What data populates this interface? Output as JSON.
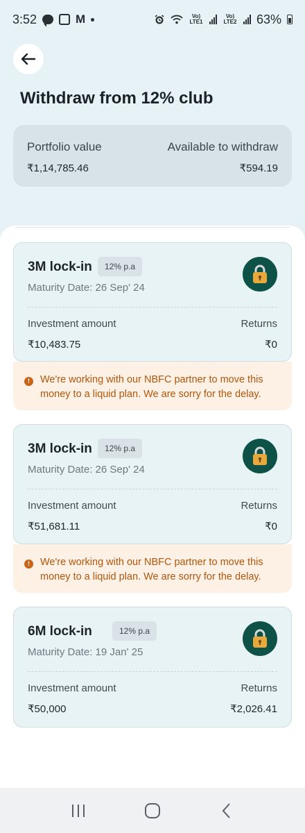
{
  "status_bar": {
    "time": "3:52",
    "sim1": "Vo) LTE1",
    "sim2": "Vo) LTE2",
    "battery": "63%"
  },
  "header": {
    "title": "Withdraw from 12% club"
  },
  "portfolio": {
    "value_label": "Portfolio value",
    "value": "₹1,14,785.46",
    "available_label": "Available to withdraw",
    "available": "₹594.19"
  },
  "investments": [
    {
      "title": "3M lock-in",
      "rate": "12% p.a",
      "maturity": "Maturity Date: 26 Sep' 24",
      "investment_label": "Investment amount",
      "investment_amount": "₹10,483.75",
      "returns_label": "Returns",
      "returns": "₹0",
      "notice": "We're working with our NBFC partner to move this money to a liquid plan. We are sorry for the delay."
    },
    {
      "title": "3M lock-in",
      "rate": "12% p.a",
      "maturity": "Maturity Date: 26 Sep' 24",
      "investment_label": "Investment amount",
      "investment_amount": "₹51,681.11",
      "returns_label": "Returns",
      "returns": "₹0",
      "notice": "We're working with our NBFC partner to move this money to a liquid plan. We are sorry for the delay."
    },
    {
      "title": "6M lock-in",
      "rate": "12% p.a",
      "maturity": "Maturity Date: 19 Jan' 25",
      "investment_label": "Investment amount",
      "investment_amount": "₹50,000",
      "returns_label": "Returns",
      "returns": "₹2,026.41"
    }
  ],
  "colors": {
    "background": "#e6f2f5",
    "lock_badge": "#0e5247",
    "lock_icon": "#e8a93a",
    "notice_text": "#b1560b",
    "notice_bg": "#fdf0e5"
  },
  "icons": {
    "back": "arrow-left-icon",
    "lock": "padlock-icon",
    "notice": "info-icon",
    "nav_recents": "recents-icon",
    "nav_home": "home-icon",
    "nav_back": "back-chevron-icon"
  }
}
